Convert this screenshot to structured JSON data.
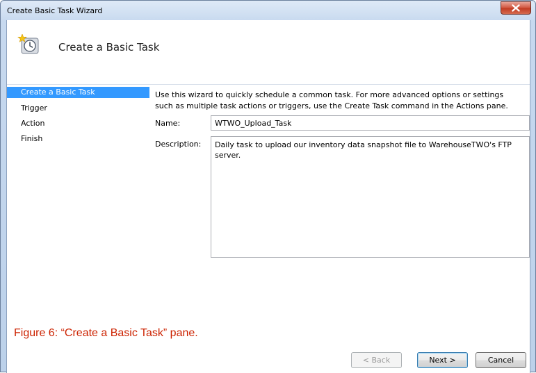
{
  "window": {
    "title": "Create Basic Task Wizard"
  },
  "header": {
    "title": "Create a Basic Task",
    "icon": "task-scheduler-clock-icon"
  },
  "nav": {
    "items": [
      {
        "label": "Create a Basic Task",
        "active": true
      },
      {
        "label": "Trigger",
        "active": false
      },
      {
        "label": "Action",
        "active": false
      },
      {
        "label": "Finish",
        "active": false
      }
    ]
  },
  "content": {
    "intro": "Use this wizard to quickly schedule a common task.  For more advanced options or settings such as multiple task actions or triggers, use the Create Task command in the Actions pane.",
    "name_label": "Name:",
    "name_value": "WTWO_Upload_Task",
    "description_label": "Description:",
    "description_value": "Daily task to upload our inventory data snapshot file to WarehouseTWO's FTP server."
  },
  "caption": "Figure 6:  “Create a Basic Task” pane.",
  "buttons": {
    "back": "< Back",
    "next": "Next >",
    "cancel": "Cancel"
  },
  "colors": {
    "selection": "#3399ff",
    "caption": "#cc2200",
    "close": "#c03a22"
  }
}
